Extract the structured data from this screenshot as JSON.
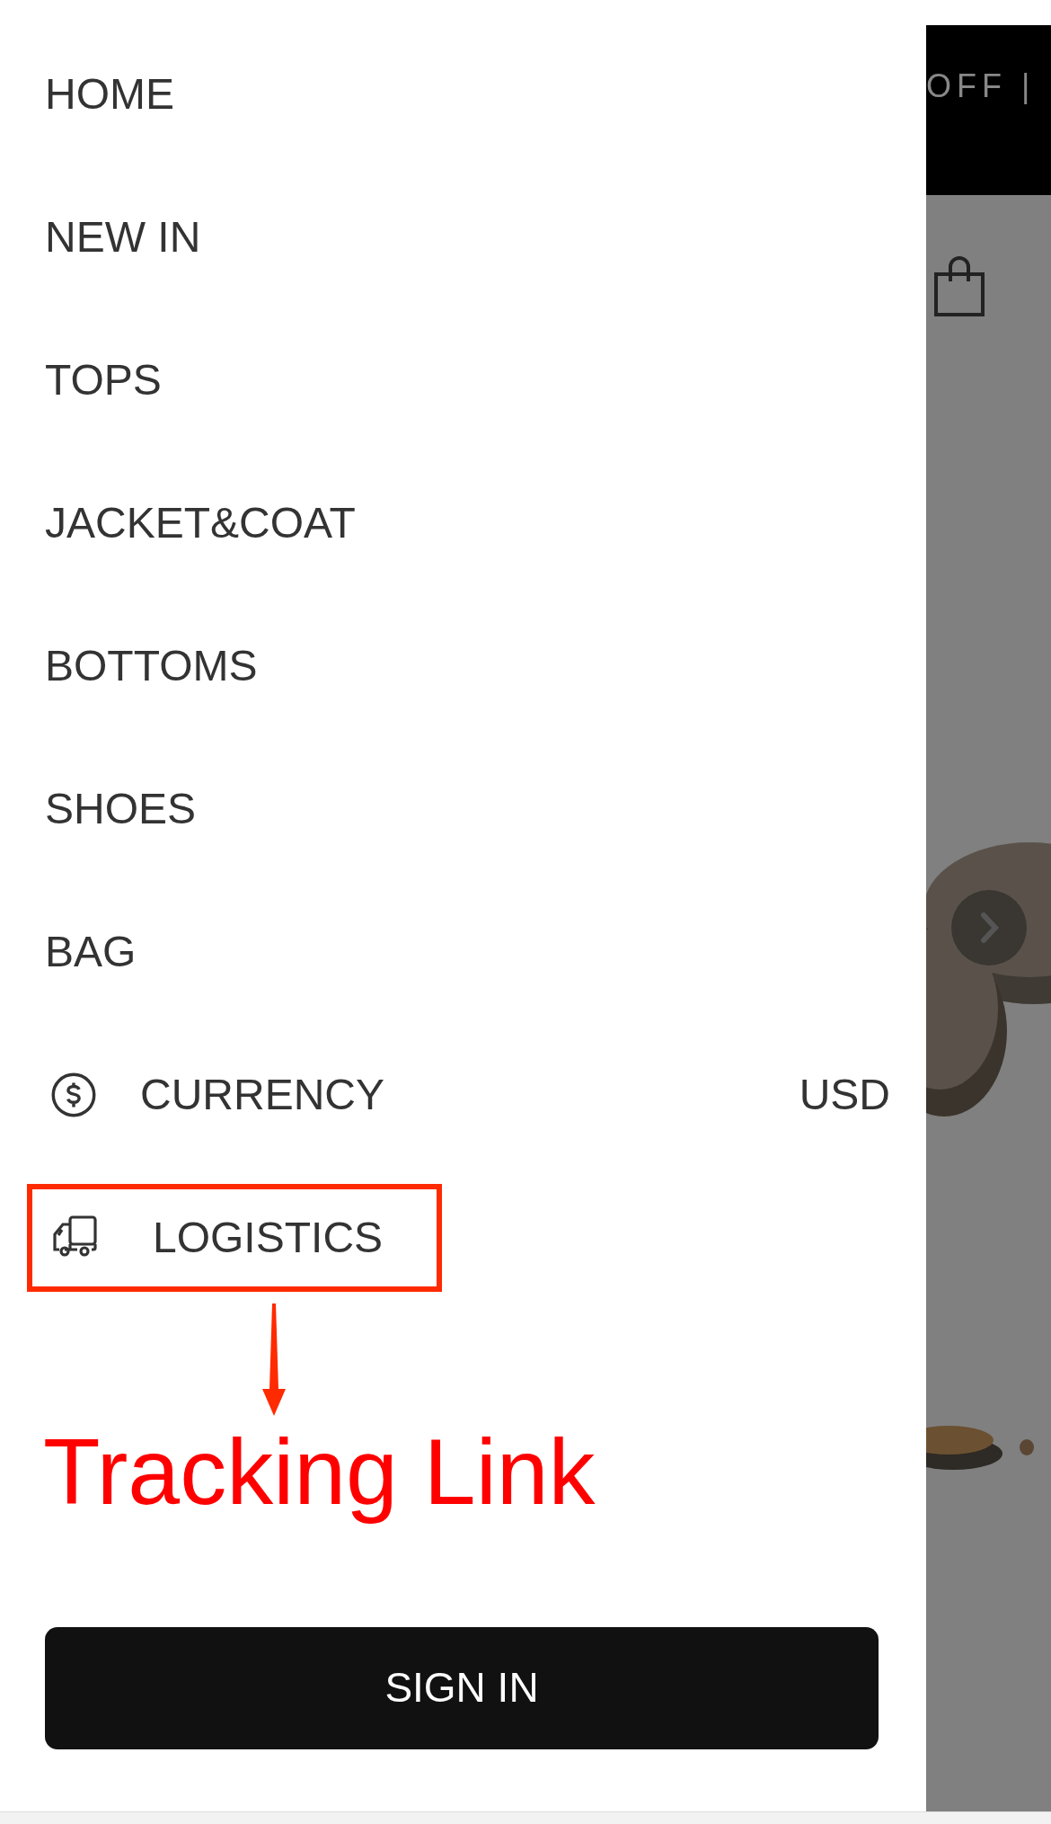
{
  "menu": [
    {
      "kind": "category",
      "label": "HOME",
      "highlighted": false
    },
    {
      "kind": "category",
      "label": "NEW IN",
      "highlighted": false
    },
    {
      "kind": "category",
      "label": "TOPS",
      "highlighted": false
    },
    {
      "kind": "category",
      "label": "JACKET&COAT",
      "highlighted": false
    },
    {
      "kind": "category",
      "label": "BOTTOMS",
      "highlighted": false
    },
    {
      "kind": "category",
      "label": "SHOES",
      "highlighted": false
    },
    {
      "kind": "category",
      "label": "BAG",
      "highlighted": false
    },
    {
      "kind": "currency",
      "label": "CURRENCY",
      "value": "USD",
      "highlighted": false
    },
    {
      "kind": "logistics",
      "label": "LOGISTICS",
      "highlighted": true
    }
  ],
  "annotation": {
    "text": "Tracking Link"
  },
  "sign_in_button": "SIGN IN",
  "background_page": {
    "banner_text": "OFF |"
  }
}
